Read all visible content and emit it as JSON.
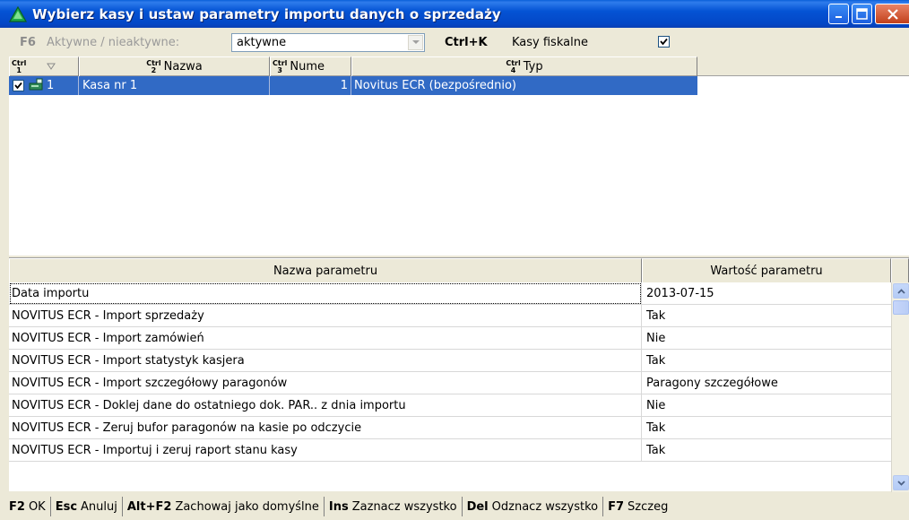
{
  "window": {
    "title": "Wybierz kasy i ustaw parametry importu danych o sprzedaży",
    "icon": "green-triangle-icon"
  },
  "filter": {
    "key": "F6",
    "label": "Aktywne / nieaktywne:",
    "value": "aktywne",
    "fiscal_key": "Ctrl+K",
    "fiscal_label": "Kasy fiskalne",
    "fiscal_checked": true
  },
  "registers": {
    "columns": [
      {
        "ctrl_top": "Ctrl",
        "ctrl_num": "1",
        "label": ""
      },
      {
        "ctrl_top": "Ctrl",
        "ctrl_num": "2",
        "label": "Nazwa"
      },
      {
        "ctrl_top": "Ctrl",
        "ctrl_num": "3",
        "label": "Nume"
      },
      {
        "ctrl_top": "Ctrl",
        "ctrl_num": "4",
        "label": "Typ"
      }
    ],
    "rows": [
      {
        "checked": true,
        "index": "1",
        "name": "Kasa nr 1",
        "number": "1",
        "type": "Novitus ECR (bezpośrednio)"
      }
    ]
  },
  "params": {
    "header_name": "Nazwa parametru",
    "header_value": "Wartość parametru",
    "rows": [
      {
        "name": "Data importu",
        "value": "2013-07-15"
      },
      {
        "name": "NOVITUS ECR - Import sprzedaży",
        "value": "Tak"
      },
      {
        "name": "NOVITUS ECR - Import zamówień",
        "value": "Nie"
      },
      {
        "name": "NOVITUS ECR - Import statystyk kasjera",
        "value": "Tak"
      },
      {
        "name": "NOVITUS ECR - Import szczegółowy paragonów",
        "value": "Paragony szczegółowe"
      },
      {
        "name": "NOVITUS ECR - Doklej dane do ostatniego dok. PAR.. z dnia importu",
        "value": "Nie"
      },
      {
        "name": "NOVITUS ECR - Zeruj bufor paragonów na kasie po odczycie",
        "value": "Tak"
      },
      {
        "name": "NOVITUS ECR - Importuj i zeruj raport stanu kasy",
        "value": "Tak"
      }
    ]
  },
  "footer": {
    "items": [
      {
        "key": "F2",
        "label": "OK"
      },
      {
        "key": "Esc",
        "label": "Anuluj"
      },
      {
        "key": "Alt+F2",
        "label": "Zachowaj jako domyślne"
      },
      {
        "key": "Ins",
        "label": "Zaznacz wszystko"
      },
      {
        "key": "Del",
        "label": "Odznacz wszystko"
      },
      {
        "key": "F7",
        "label": "Szczeg"
      }
    ]
  }
}
